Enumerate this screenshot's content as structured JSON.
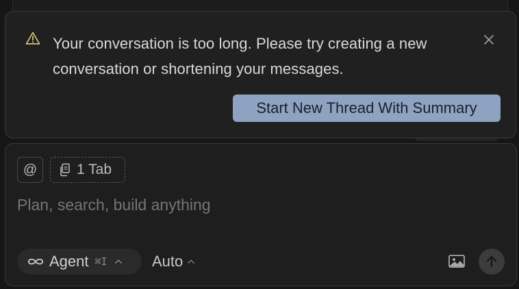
{
  "warning": {
    "icon": "warning-triangle-icon",
    "message": "Your conversation is too long. Please try creating a new conversation or shortening your messages.",
    "close_icon": "close-icon",
    "action_label": "Start New Thread With Summary",
    "action_color": "#8ea3c2"
  },
  "composer": {
    "mention_icon": "at-icon",
    "context_chip_label": "1 Tab",
    "context_chip_icon": "copy-files-icon",
    "placeholder": "Plan, search, build anything",
    "mode": {
      "icon": "infinity-icon",
      "label": "Agent",
      "shortcut": "⌘I"
    },
    "model_label": "Auto",
    "image_icon": "image-icon",
    "send_icon": "arrow-up-icon"
  }
}
